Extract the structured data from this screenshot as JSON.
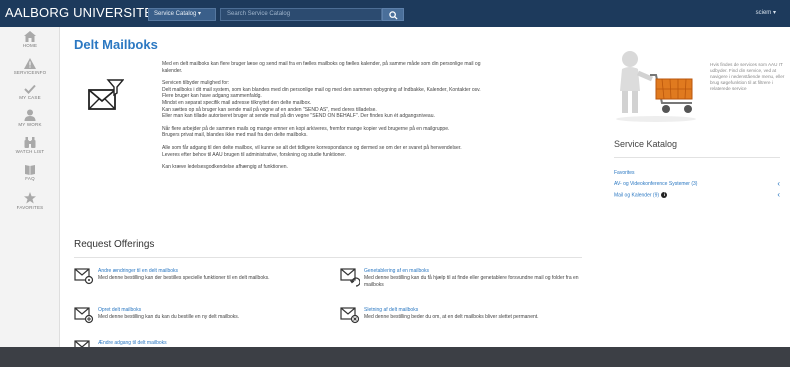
{
  "header": {
    "brand": "AALBORG UNIVERSITET",
    "service_catalog_dropdown": "Service Catalog ▾",
    "search_placeholder": "Search Service Catalog",
    "user_menu": "sciem ▾"
  },
  "sidebar": {
    "items": [
      {
        "label": "HOME",
        "icon": "home-icon"
      },
      {
        "label": "SERVICEINFO",
        "icon": "warning-icon"
      },
      {
        "label": "MY CASE",
        "icon": "check-icon"
      },
      {
        "label": "MY WORK",
        "icon": "user-icon"
      },
      {
        "label": "WATCH LIST",
        "icon": "binoculars-icon"
      },
      {
        "label": "FAQ",
        "icon": "book-icon"
      },
      {
        "label": "FAVORITES",
        "icon": "star-icon"
      }
    ]
  },
  "main": {
    "title": "Delt Mailboks",
    "description": [
      "Med en delt mailboks kan flere bruger læse og send mail fra en fælles mailboks og fælles kalender, på samme måde som din personlige mail og",
      "kalender.",
      "",
      "Servicen tilbyder mulighed for:",
      "Delt mailboks i dit mail system, som kan blandes med din personlige mail og med den sammen opbygning af Indbakke, Kalender, Kontakter osv.",
      "Flere bruger kan have adgang sammenfaldg.",
      "Mindst en separat specifik mail adresse tilknyttet den delte mailbox.",
      "Kan sættes op så bruger kan sende mail på vegne af en anden \"SEND AS\", med deres tilladelse.",
      "Eller man kan tillade autoriseret bruger at sende mail på din vegne \"SEND ON BEHALF\". Der findes kun ét adgangsniveau.",
      "",
      "Når flere arbejder på de sammen mails og mange emner en kopi arkiveres, fremfor mange kopier ved brugerne på en mailgruppe.",
      "Brugers privat mail, blandes ikke med mail fra den delte mailboks.",
      "",
      "Alle som får adgang til den delte mailbox, vil kunne se alt det tidligere korrespondance og dermed se om der er svaret på henvendelser.",
      "Leveres efter behov til AAU brugen til administrative, forskning og studie funktioner.",
      "",
      "Kan kræve ledelsesgodkendelse afhængig af funktionen."
    ],
    "request_offerings_title": "Request Offerings",
    "offerings": [
      {
        "title": "Andre ændringer til en delt mailboks",
        "desc": "Med denne bestilling kan der bestilles specielle funktioner til en delt mailboks.",
        "icon": "mail-settings-icon"
      },
      {
        "title": "Genetablering af en mailboks",
        "desc": "Med denne bestilling kan du få hjælp til at finde eller genetablere forsvundne mail og folder fra en mailboks",
        "icon": "mail-restore-icon"
      },
      {
        "title": "Opret delt mailboks",
        "desc": "Med denne bestilling kan du kan du bestille en ny delt mailboks.",
        "icon": "mail-new-icon"
      },
      {
        "title": "Sletning af delt mailboks",
        "desc": "Med denne bestilling beder du om, at en delt mailboks bliver slettet permanent.",
        "icon": "mail-delete-icon"
      },
      {
        "title": "Ændre adgang til delt mailboks",
        "desc": "",
        "icon": "mail-access-icon"
      }
    ]
  },
  "right": {
    "promo_text": "Hvis findes de services som AAU IT udbyder. Find din service, ved at navigere i nedenstående menu, eller brug søgefunktion til at filtrere i relaterede service",
    "service_katalog_title": "Service Katalog",
    "favorites_heading": "Favorites",
    "favorites": [
      {
        "label": "AV- og Videokonference Systemer (3)",
        "info": false
      },
      {
        "label": "Mail og Kalender (9)",
        "info": true
      }
    ]
  },
  "colors": {
    "header_bg": "#1d3a5c",
    "accent_blue": "#2b78c2",
    "footer_bg": "#3c3f45"
  }
}
